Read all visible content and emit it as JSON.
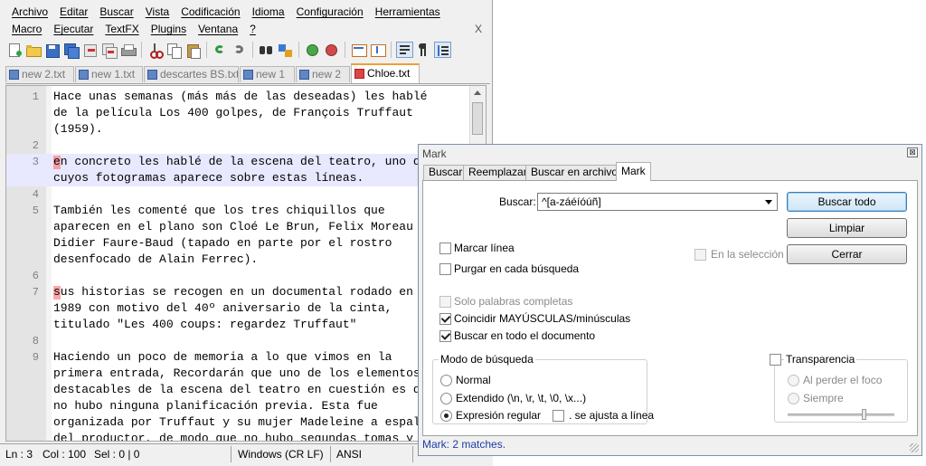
{
  "menu": {
    "row1": [
      "Archivo",
      "Editar",
      "Buscar",
      "Vista",
      "Codificación",
      "Idioma",
      "Configuración",
      "Herramientas"
    ],
    "row2": [
      "Macro",
      "Ejecutar",
      "TextFX",
      "Plugins",
      "Ventana",
      "?"
    ],
    "close": "X"
  },
  "toolbar_icons": [
    "new-file",
    "open-file",
    "save",
    "save-all",
    "close",
    "close-all",
    "print",
    "cut",
    "copy",
    "paste",
    "undo",
    "redo",
    "find",
    "replace",
    "zoom-in",
    "zoom-out",
    "sync-vertical",
    "sync-horizontal",
    "wrap",
    "show-all-chars",
    "indent-guide"
  ],
  "tabs": [
    {
      "label": "new 2.txt",
      "active": false
    },
    {
      "label": "new 1.txt",
      "active": false
    },
    {
      "label": "descartes BS.txt",
      "active": false
    },
    {
      "label": "new 1",
      "active": false
    },
    {
      "label": "new 2",
      "active": false
    },
    {
      "label": "Chloe.txt",
      "active": true
    }
  ],
  "editor": {
    "lines": [
      {
        "num": "1",
        "text": "Hace unas semanas (más más de las deseadas) les hablé"
      },
      {
        "num": "",
        "text": "de la película Los 400 golpes, de François Truffaut"
      },
      {
        "num": "",
        "text": "(1959)."
      },
      {
        "num": "2",
        "text": ""
      },
      {
        "num": "3",
        "text": "en concreto les hablé de la escena del teatro, uno de"
      },
      {
        "num": "",
        "text": "cuyos fotogramas aparece sobre estas líneas."
      },
      {
        "num": "4",
        "text": ""
      },
      {
        "num": "5",
        "text": "También les comenté que los tres chiquillos que"
      },
      {
        "num": "",
        "text": "aparecen en el plano son Cloé Le Brun, Felix Moreau y"
      },
      {
        "num": "",
        "text": "Didier Faure-Baud (tapado en parte por el rostro"
      },
      {
        "num": "",
        "text": "desenfocado de Alain Ferrec)."
      },
      {
        "num": "6",
        "text": ""
      },
      {
        "num": "7",
        "text": "sus historias se recogen en un documental rodado en"
      },
      {
        "num": "",
        "text": "1989 con motivo del 40º aniversario de la cinta,"
      },
      {
        "num": "",
        "text": "titulado \"Les 400 coups: regardez Truffaut\""
      },
      {
        "num": "8",
        "text": ""
      },
      {
        "num": "9",
        "text": "Haciendo un poco de memoria a lo que vimos en la"
      },
      {
        "num": "",
        "text": "primera entrada, Recordarán que uno de los elementos"
      },
      {
        "num": "",
        "text": "destacables de la escena del teatro en cuestión es que"
      },
      {
        "num": "",
        "text": "no hubo ninguna planificación previa. Esta fue"
      },
      {
        "num": "",
        "text": "organizada por Truffaut y su mujer Madeleine a espaldas"
      },
      {
        "num": "",
        "text": "del productor, de modo que no hubo segundas tomas y"
      }
    ]
  },
  "status": {
    "ln": "Ln : 3",
    "col": "Col : 100",
    "sel": "Sel : 0 | 0",
    "eol": "Windows (CR LF)",
    "encoding": "ANSI"
  },
  "dialog": {
    "title": "Mark",
    "close": "⊠",
    "tabs": [
      "Buscar",
      "Reemplazar",
      "Buscar en archivos",
      "Mark"
    ],
    "search_label": "Buscar:",
    "search_value": "^[a-záéíóúñ]",
    "buttons": {
      "find_all": "Buscar todo",
      "clear": "Limpiar",
      "close": "Cerrar"
    },
    "in_selection": "En la selección",
    "bookmark_line": "Marcar línea",
    "purge": "Purgar en cada búsqueda",
    "whole_word": "Solo palabras completas",
    "match_case": "Coincidir MAYÚSCULAS/minúsculas",
    "wrap_around": "Buscar en todo el documento",
    "search_mode": {
      "title": "Modo de búsqueda",
      "normal": "Normal",
      "extended": "Extendido (\\n, \\r, \\t, \\0, \\x...)",
      "regex": "Expresión regular",
      "dot_newline": ". se ajusta a línea",
      "selected": "regex"
    },
    "transparency": {
      "title": "Transparencia",
      "on_lose_focus": "Al perder el foco",
      "always": "Siempre"
    },
    "status": "Mark: 2 matches."
  }
}
